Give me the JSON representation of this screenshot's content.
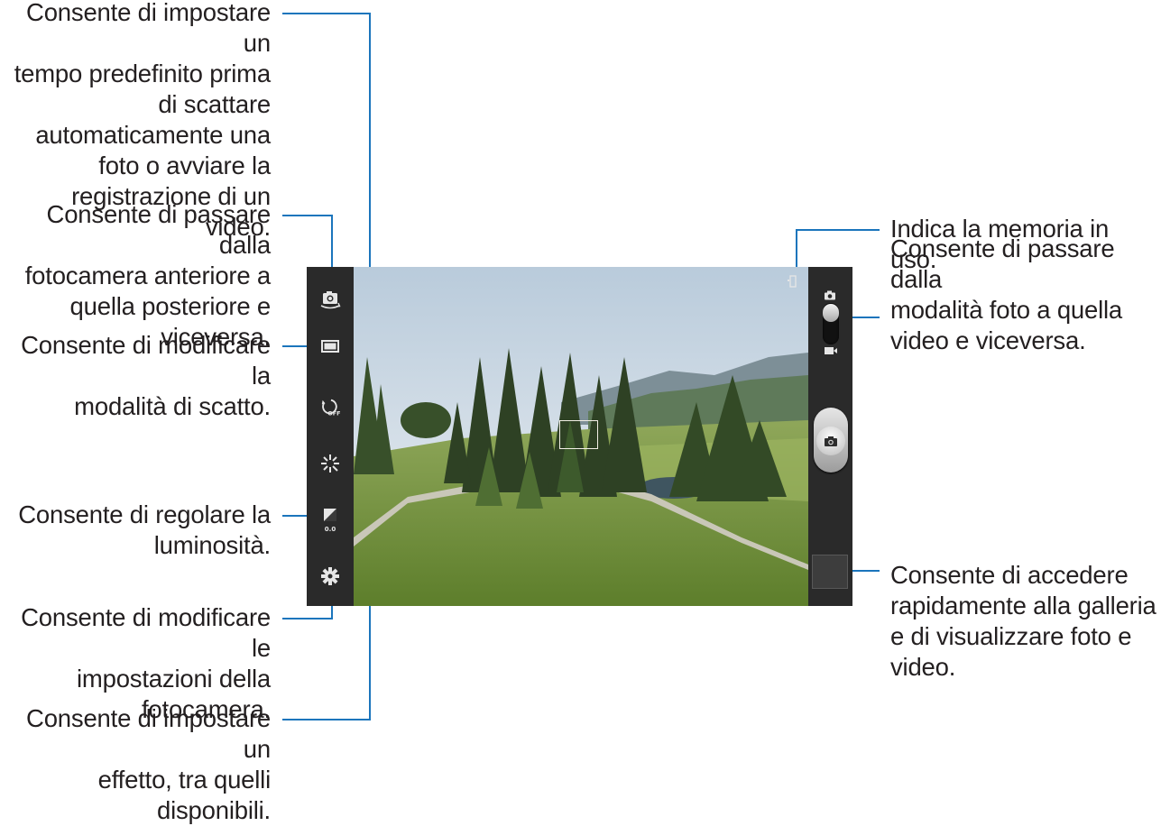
{
  "annotations": {
    "timer": "Consente di impostare un\ntempo predefinito prima\ndi scattare\nautomaticamente una\nfoto o avviare la\nregistrazione di un video.",
    "switch_camera": "Consente di passare dalla\nfotocamera anteriore a\nquella posteriore e\nviceversa.",
    "shooting_mode": "Consente di modificare la\nmodalità di scatto.",
    "brightness": "Consente di regolare la\nluminosità.",
    "settings": "Consente di modificare le\nimpostazioni della\nfotocamera.",
    "effects": "Consente di impostare un\neffetto, tra quelli\ndisponibili.",
    "storage": "Indica la memoria in uso.",
    "mode_switch": "Consente di passare dalla\nmodalità foto a quella\nvideo e viceversa.",
    "gallery": "Consente di accedere\nrapidamente alla galleria\ne di visualizzare foto e\nvideo."
  },
  "camera_ui": {
    "timer_icon_label": "OFF",
    "exposure_value": "0.0",
    "mode_selected": "photo",
    "icons": {
      "left_bar": [
        "switch-camera-icon",
        "shooting-mode-icon",
        "timer-icon",
        "effects-icon",
        "exposure-icon",
        "settings-icon"
      ],
      "right_bar": [
        "storage-icon",
        "photo-mode-icon",
        "video-mode-icon",
        "shutter-camera-icon",
        "gallery-thumbnail"
      ]
    }
  },
  "colors": {
    "callout_line": "#1b75bc",
    "bar_background": "#2a2a2a",
    "text": "#231f20"
  }
}
